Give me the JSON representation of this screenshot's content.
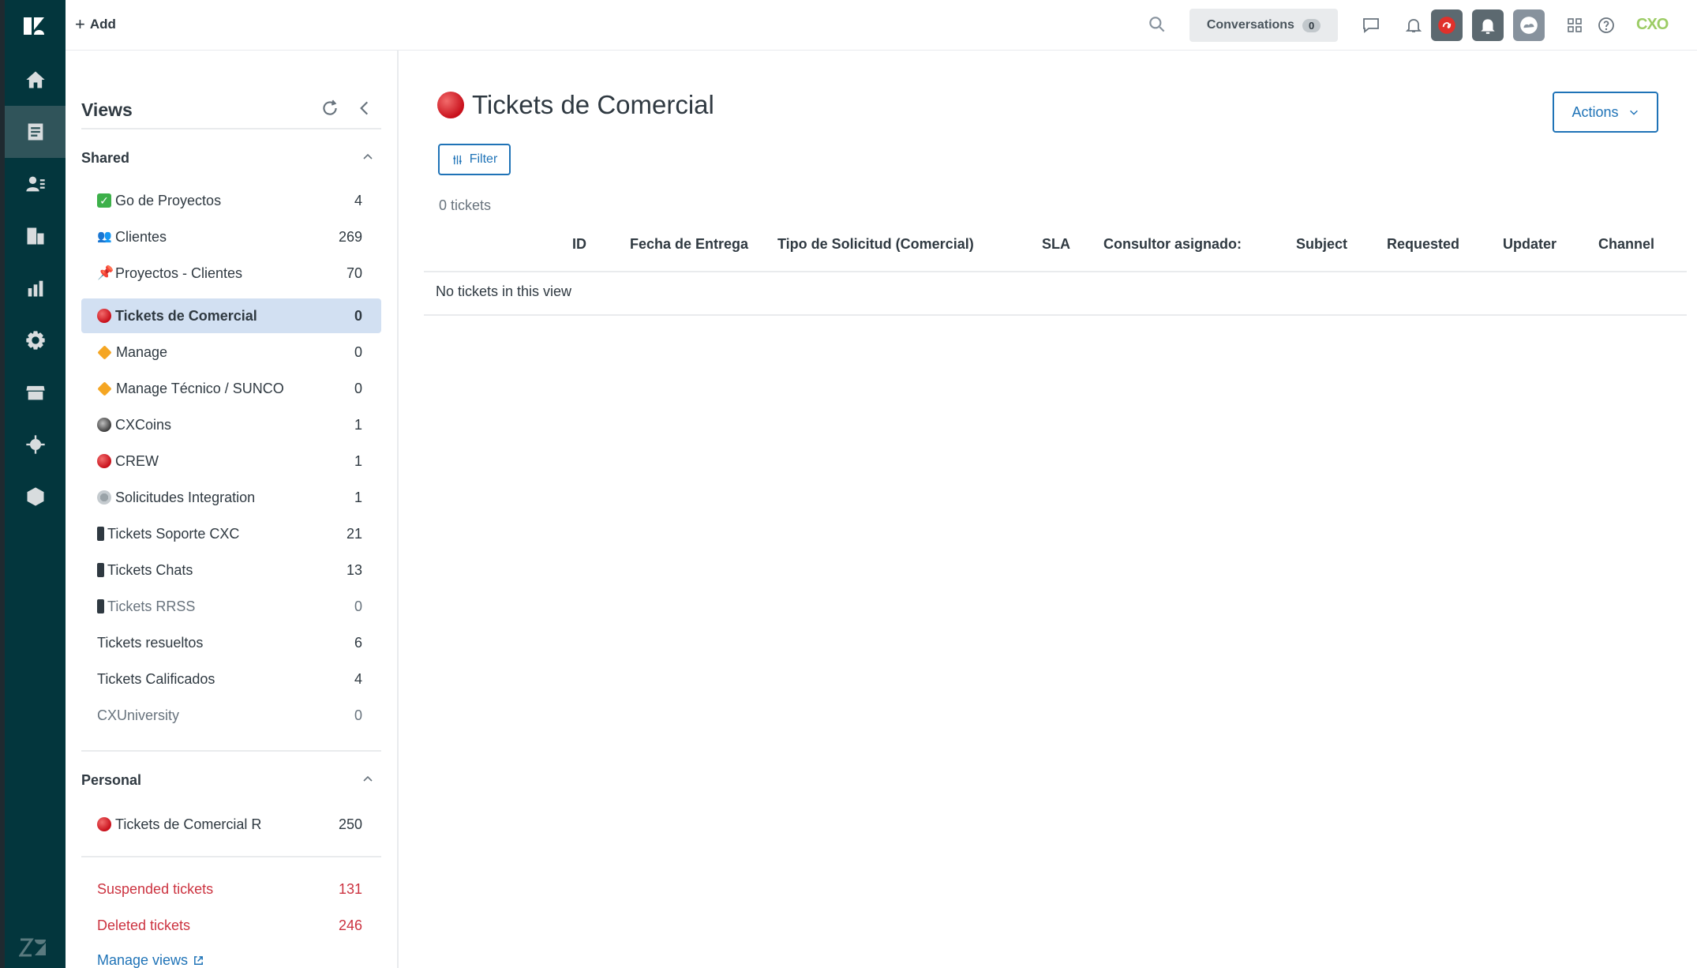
{
  "topbar": {
    "add_label": "Add",
    "conversations_label": "Conversations",
    "conversations_count": "0",
    "brand_text": "CXO"
  },
  "rail": {
    "items": [
      "home-icon",
      "views-icon",
      "customers-icon",
      "organizations-icon",
      "reporting-icon",
      "admin-icon",
      "marketplace-icon",
      "apps-icon",
      "products-icon"
    ]
  },
  "views_panel": {
    "title": "Views",
    "shared_header": "Shared",
    "shared": [
      {
        "label": "Go de Proyectos",
        "count": "4",
        "emoji": "check"
      },
      {
        "label": "Clientes",
        "count": "269",
        "emoji": "ppl"
      },
      {
        "label": "Proyectos - Clientes",
        "count": "70",
        "emoji": "pin"
      },
      {
        "label": "Tickets de Comercial",
        "count": "0",
        "emoji": "red"
      },
      {
        "label": "Manage",
        "count": "0",
        "emoji": "orange"
      },
      {
        "label": "Manage Técnico / SUNCO",
        "count": "0",
        "emoji": "orange"
      },
      {
        "label": "CXCoins",
        "count": "1",
        "emoji": "coin"
      },
      {
        "label": "CREW",
        "count": "1",
        "emoji": "red"
      },
      {
        "label": "Solicitudes Integration",
        "count": "1",
        "emoji": "gear"
      },
      {
        "label": "Tickets Soporte CXC",
        "count": "21",
        "emoji": "phone"
      },
      {
        "label": "Tickets Chats",
        "count": "13",
        "emoji": "phone"
      },
      {
        "label": "Tickets RRSS",
        "count": "0",
        "emoji": "phone"
      },
      {
        "label": "Tickets resueltos",
        "count": "6",
        "emoji": ""
      },
      {
        "label": "Tickets Calificados",
        "count": "4",
        "emoji": ""
      },
      {
        "label": "CXUniversity",
        "count": "0",
        "emoji": ""
      }
    ],
    "personal_header": "Personal",
    "personal": [
      {
        "label": "Tickets de Comercial R",
        "count": "250",
        "emoji": "red"
      }
    ],
    "suspended": {
      "label": "Suspended tickets",
      "count": "131"
    },
    "deleted": {
      "label": "Deleted tickets",
      "count": "246"
    },
    "manage_views": "Manage views"
  },
  "main": {
    "title": "Tickets de Comercial",
    "actions_label": "Actions",
    "filter_label": "Filter",
    "ticket_count": "0 tickets",
    "columns": [
      "ID",
      "Fecha de Entrega",
      "Tipo de Solicitud (Comercial)",
      "SLA",
      "Consultor asignado:",
      "Subject",
      "Requested",
      "Updater",
      "Channel"
    ],
    "empty_message": "No tickets in this view"
  },
  "colors": {
    "rail_bg": "#03363d",
    "active_view_bg": "#d2e0f2",
    "link_blue": "#1f73b7",
    "danger_red": "#cc3340"
  }
}
